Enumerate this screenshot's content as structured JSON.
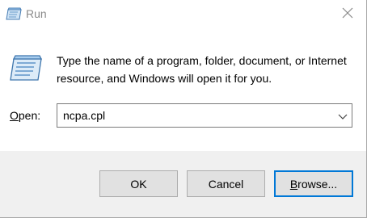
{
  "window": {
    "title": "Run"
  },
  "icons": {
    "title": "run-icon",
    "big": "run-icon",
    "close": "close-icon",
    "dropdown": "chevron-down-icon"
  },
  "description": "Type the name of a program, folder, document, or Internet resource, and Windows will open it for you.",
  "open_field": {
    "label_prefix": "",
    "label_mnemonic": "O",
    "label_rest": "pen:",
    "value": "ncpa.cpl"
  },
  "buttons": {
    "ok": "OK",
    "cancel": "Cancel",
    "browse_mnemonic": "B",
    "browse_rest": "rowse..."
  },
  "colors": {
    "focus_border": "#0078d7",
    "footer_bg": "#f0f0f0",
    "button_bg": "#e1e1e1"
  }
}
